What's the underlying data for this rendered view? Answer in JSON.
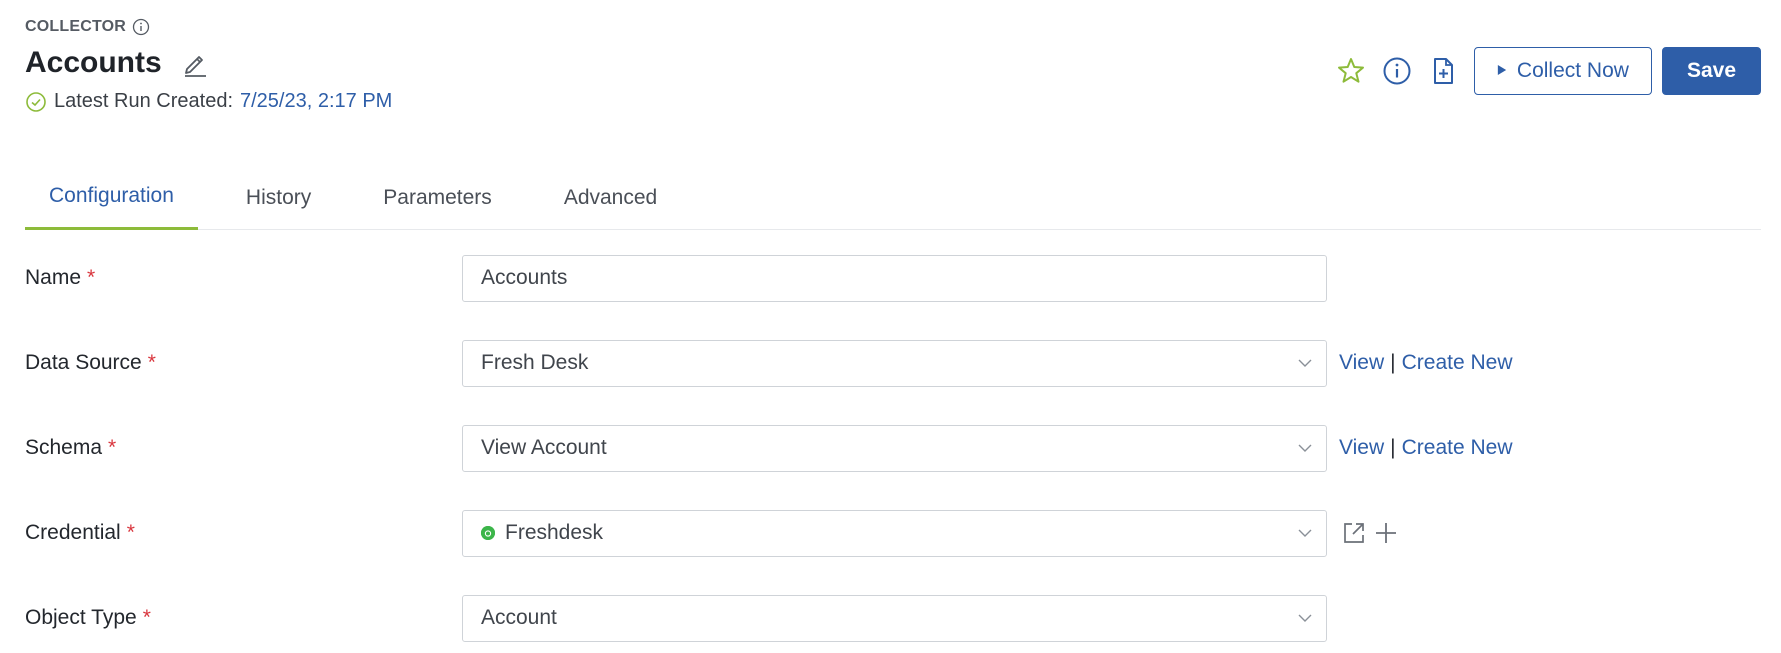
{
  "header": {
    "eyebrow": "COLLECTOR",
    "title": "Accounts",
    "latest_label": "Latest Run Created:",
    "latest_value": "7/25/23, 2:17 PM"
  },
  "actions": {
    "collect_label": "Collect Now",
    "save_label": "Save"
  },
  "tabs": [
    {
      "label": "Configuration",
      "active": true
    },
    {
      "label": "History",
      "active": false
    },
    {
      "label": "Parameters",
      "active": false
    },
    {
      "label": "Advanced",
      "active": false
    }
  ],
  "form": {
    "name": {
      "label": "Name",
      "value": "Accounts"
    },
    "data_source": {
      "label": "Data Source",
      "value": "Fresh Desk",
      "view_link": "View",
      "separator": "|",
      "create_link": "Create New"
    },
    "schema": {
      "label": "Schema",
      "value": "View Account",
      "view_link": "View",
      "separator": "|",
      "create_link": "Create New"
    },
    "credential": {
      "label": "Credential",
      "value": "Freshdesk"
    },
    "object_type": {
      "label": "Object Type",
      "value": "Account"
    },
    "required_mark": "*"
  },
  "colors": {
    "accent": "#2e5ea8",
    "tab_underline": "#8dbb3a",
    "success": "#8dbb3a",
    "required": "#d9363e"
  },
  "icons": [
    "info-icon",
    "edit-icon",
    "check-circle-icon",
    "star-icon",
    "info-circle-icon",
    "add-file-icon",
    "play-icon",
    "chevron-down-icon",
    "external-link-icon",
    "plus-icon"
  ]
}
